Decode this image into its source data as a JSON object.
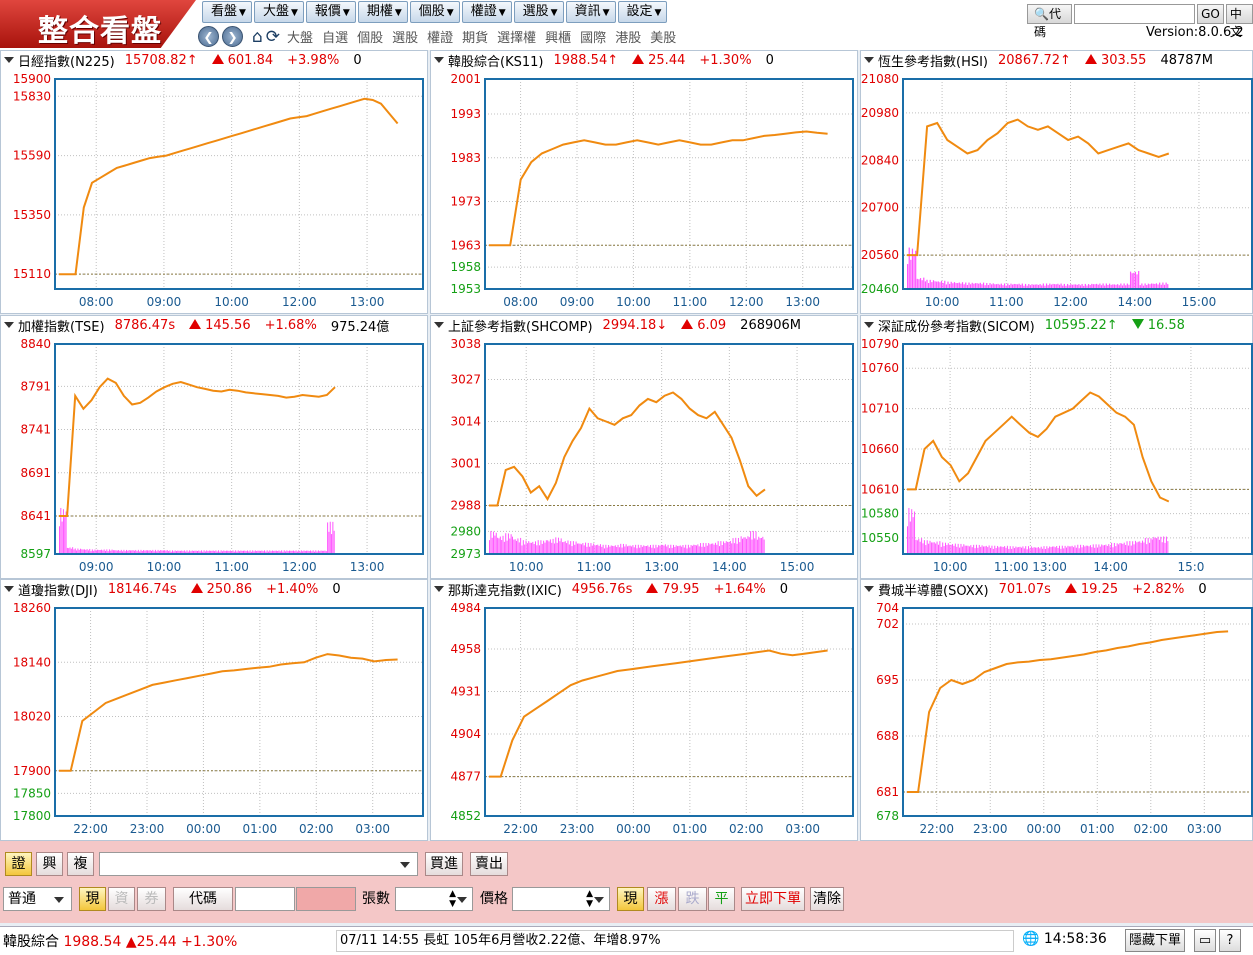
{
  "app": {
    "logo": "整合看盤",
    "version": "Version:8.0.6.2"
  },
  "menu": [
    {
      "label": "看盤"
    },
    {
      "label": "大盤"
    },
    {
      "label": "報價"
    },
    {
      "label": "期權"
    },
    {
      "label": "個股"
    },
    {
      "label": "權證"
    },
    {
      "label": "選股"
    },
    {
      "label": "資訊"
    },
    {
      "label": "設定"
    }
  ],
  "nav_links": [
    "大盤",
    "自選",
    "個股",
    "選股",
    "權證",
    "期貨",
    "選擇權",
    "興櫃",
    "國際",
    "港股",
    "美股"
  ],
  "search": {
    "label": "代碼",
    "value": "",
    "go": "GO",
    "extra": "中文"
  },
  "panels": [
    {
      "id": "n225",
      "name": "日經指數(N225)",
      "price": "15708.82",
      "price_dir": "↑",
      "price_color": "red",
      "chg_dir": "up",
      "change": "601.84",
      "pct": "+3.98%",
      "vol": "0",
      "yticks": [
        "15900",
        "15830",
        "15590",
        "15350",
        "15110"
      ],
      "xticks": [
        "08:00",
        "09:00",
        "10:00",
        "12:00",
        "13:00"
      ],
      "ref": 15110,
      "ymin": 15050,
      "ymax": 15900,
      "series": [
        15110,
        15110,
        15110,
        15380,
        15480,
        15500,
        15520,
        15540,
        15550,
        15560,
        15570,
        15580,
        15585,
        15590,
        15600,
        15610,
        15620,
        15630,
        15640,
        15650,
        15660,
        15670,
        15680,
        15690,
        15700,
        15710,
        15720,
        15730,
        15740,
        15745,
        15750,
        15760,
        15770,
        15780,
        15790,
        15800,
        15810,
        15820,
        15815,
        15800,
        15760,
        15720
      ],
      "volume": []
    },
    {
      "id": "ks11",
      "name": "韓股綜合(KS11)",
      "price": "1988.54",
      "price_dir": "↑",
      "price_color": "red",
      "chg_dir": "up",
      "change": "25.44",
      "pct": "+1.30%",
      "vol": "0",
      "yticks": [
        "2001",
        "1993",
        "1983",
        "1973",
        "1963",
        "1958",
        "1953"
      ],
      "xticks": [
        "08:00",
        "09:00",
        "10:00",
        "11:00",
        "12:00",
        "13:00"
      ],
      "ref": 1963,
      "ymin": 1953,
      "ymax": 2001,
      "series": [
        1963,
        1963,
        1963,
        1978,
        1982,
        1984,
        1985,
        1986,
        1986.5,
        1987,
        1986.5,
        1986,
        1986,
        1986.5,
        1987,
        1986.5,
        1986,
        1986.5,
        1987,
        1986.5,
        1986,
        1986,
        1986.5,
        1987,
        1987,
        1987.5,
        1988,
        1988.2,
        1988.5,
        1988.8,
        1989,
        1988.7,
        1988.5
      ],
      "volume": []
    },
    {
      "id": "hsi",
      "name": "恆生參考指數(HSI)",
      "price": "20867.72",
      "price_dir": "↑",
      "price_color": "red",
      "chg_dir": "up",
      "change": "303.55",
      "pct": "",
      "vol": "48787M",
      "yticks": [
        "21080",
        "20980",
        "20840",
        "20700",
        "20560",
        "20460"
      ],
      "xticks": [
        "10:00",
        "11:00",
        "12:00",
        "14:00",
        "15:00"
      ],
      "ref": 20560,
      "ymin": 20460,
      "ymax": 21080,
      "series": [
        20560,
        20560,
        20940,
        20950,
        20900,
        20880,
        20860,
        20870,
        20900,
        20920,
        20950,
        20960,
        20940,
        20930,
        20940,
        20920,
        20900,
        20910,
        20890,
        20860,
        20870,
        20880,
        20890,
        20870,
        20860,
        20850,
        20860
      ],
      "volume": [
        0.9,
        0.25,
        0.2,
        0.18,
        0.16,
        0.15,
        0.14,
        0.14,
        0.13,
        0.12,
        0.12,
        0.12,
        0.11,
        0.11,
        0.12,
        0.12,
        0.11,
        0.11,
        0.11,
        0.12,
        0.12,
        0.11,
        0.12,
        0.4,
        0.12,
        0.13,
        0.14
      ]
    },
    {
      "id": "tse",
      "name": "加權指數(TSE)",
      "price": "8786.47",
      "price_dir": "s",
      "price_color": "red",
      "chg_dir": "up",
      "change": "145.56",
      "pct": "+1.68%",
      "vol": "975.24億",
      "yticks": [
        "8840",
        "8791",
        "8741",
        "8691",
        "8641",
        "8597"
      ],
      "xticks": [
        "09:00",
        "10:00",
        "11:00",
        "12:00",
        "13:00"
      ],
      "ref": 8641,
      "ymin": 8597,
      "ymax": 8840,
      "series": [
        8641,
        8641,
        8780,
        8765,
        8775,
        8790,
        8800,
        8795,
        8780,
        8770,
        8772,
        8778,
        8785,
        8790,
        8794,
        8796,
        8793,
        8790,
        8788,
        8786,
        8785,
        8787,
        8786,
        8784,
        8783,
        8782,
        8781,
        8780,
        8778,
        8779,
        8781,
        8780,
        8779,
        8781,
        8790
      ],
      "volume": [
        1,
        0.15,
        0.12,
        0.11,
        0.1,
        0.1,
        0.1,
        0.09,
        0.09,
        0.09,
        0.09,
        0.09,
        0.09,
        0.09,
        0.08,
        0.08,
        0.08,
        0.08,
        0.08,
        0.08,
        0.08,
        0.08,
        0.08,
        0.08,
        0.08,
        0.08,
        0.08,
        0.08,
        0.08,
        0.08,
        0.08,
        0.08,
        0.08,
        0.08,
        0.7
      ]
    },
    {
      "id": "shcomp",
      "name": "上証參考指數(SHCOMP)",
      "price": "2994.18",
      "price_dir": "↓",
      "price_color": "red",
      "chg_dir": "up",
      "change": "6.09",
      "pct": "",
      "vol": "268906M",
      "yticks": [
        "3038",
        "3027",
        "3014",
        "3001",
        "2988",
        "2980",
        "2973"
      ],
      "xticks": [
        "10:00",
        "11:00",
        "13:00",
        "14:00",
        "15:00"
      ],
      "ref": 2988,
      "ymin": 2973,
      "ymax": 3038,
      "series": [
        2988,
        2988,
        2999,
        3000,
        2997,
        2992,
        2994,
        2990,
        2995,
        3003,
        3008,
        3012,
        3018,
        3015,
        3014,
        3013,
        3015,
        3016,
        3019,
        3021,
        3020,
        3022,
        3023,
        3021,
        3018,
        3016,
        3015,
        3017,
        3013,
        3009,
        3002,
        2994,
        2991,
        2993
      ],
      "volume": [
        0.5,
        0.4,
        0.45,
        0.35,
        0.3,
        0.28,
        0.3,
        0.33,
        0.36,
        0.3,
        0.28,
        0.25,
        0.24,
        0.22,
        0.2,
        0.2,
        0.22,
        0.2,
        0.2,
        0.2,
        0.2,
        0.22,
        0.2,
        0.2,
        0.2,
        0.22,
        0.24,
        0.25,
        0.28,
        0.3,
        0.35,
        0.4,
        0.5,
        0.4
      ]
    },
    {
      "id": "sicom",
      "name": "深証成份參考指數(SICOM)",
      "price": "10595.22",
      "price_dir": "↑",
      "price_color": "green",
      "chg_dir": "down",
      "change": "16.58",
      "pct": "",
      "vol": "",
      "yticks": [
        "10790",
        "10760",
        "10710",
        "10660",
        "10610",
        "10580",
        "10550"
      ],
      "xticks": [
        "10:00",
        "11:00 13:00",
        "14:00",
        "15:0"
      ],
      "ref": 10610,
      "ymin": 10530,
      "ymax": 10790,
      "series": [
        10610,
        10610,
        10660,
        10670,
        10650,
        10640,
        10620,
        10630,
        10650,
        10670,
        10680,
        10690,
        10700,
        10690,
        10680,
        10675,
        10685,
        10700,
        10705,
        10710,
        10720,
        10730,
        10725,
        10715,
        10705,
        10700,
        10690,
        10650,
        10620,
        10600,
        10595
      ],
      "volume": [
        1,
        0.35,
        0.3,
        0.28,
        0.25,
        0.23,
        0.22,
        0.2,
        0.2,
        0.19,
        0.18,
        0.18,
        0.17,
        0.17,
        0.17,
        0.16,
        0.17,
        0.18,
        0.18,
        0.19,
        0.2,
        0.2,
        0.21,
        0.22,
        0.24,
        0.26,
        0.28,
        0.3,
        0.35,
        0.4,
        0.38
      ]
    },
    {
      "id": "dji",
      "name": "道瓊指數(DJI)",
      "price": "18146.74",
      "price_dir": "s",
      "price_color": "red",
      "chg_dir": "up",
      "change": "250.86",
      "pct": "+1.40%",
      "vol": "0",
      "yticks": [
        "18260",
        "18140",
        "18020",
        "17900",
        "17850",
        "17800"
      ],
      "xticks": [
        "22:00",
        "23:00",
        "00:00",
        "01:00",
        "02:00",
        "03:00"
      ],
      "ref": 17900,
      "ymin": 17800,
      "ymax": 18260,
      "series": [
        17900,
        17900,
        18010,
        18030,
        18050,
        18060,
        18070,
        18080,
        18090,
        18095,
        18100,
        18105,
        18110,
        18115,
        18120,
        18122,
        18125,
        18128,
        18130,
        18135,
        18138,
        18140,
        18150,
        18158,
        18155,
        18150,
        18148,
        18142,
        18145,
        18146
      ],
      "volume": []
    },
    {
      "id": "ixic",
      "name": "那斯達克指數(IXIC)",
      "price": "4956.76",
      "price_dir": "s",
      "price_color": "red",
      "chg_dir": "up",
      "change": "79.95",
      "pct": "+1.64%",
      "vol": "0",
      "yticks": [
        "4984",
        "4958",
        "4931",
        "4904",
        "4877",
        "4852"
      ],
      "xticks": [
        "22:00",
        "23:00",
        "00:00",
        "01:00",
        "02:00",
        "03:00"
      ],
      "ref": 4877,
      "ymin": 4852,
      "ymax": 4984,
      "series": [
        4877,
        4877,
        4900,
        4915,
        4920,
        4925,
        4930,
        4935,
        4938,
        4940,
        4942,
        4944,
        4945,
        4946,
        4947,
        4948,
        4949,
        4950,
        4951,
        4952,
        4953,
        4954,
        4955,
        4956,
        4957,
        4955,
        4954,
        4955,
        4956,
        4957
      ],
      "volume": []
    },
    {
      "id": "soxx",
      "name": "費城半導體(SOXX)",
      "price": "701.07",
      "price_dir": "s",
      "price_color": "red",
      "chg_dir": "up",
      "change": "19.25",
      "pct": "+2.82%",
      "vol": "0",
      "yticks": [
        "704",
        "702",
        "695",
        "688",
        "681",
        "678"
      ],
      "xticks": [
        "22:00",
        "23:00",
        "00:00",
        "01:00",
        "02:00",
        "03:00"
      ],
      "ref": 681,
      "ymin": 678,
      "ymax": 704,
      "series": [
        681,
        681,
        691,
        694,
        695,
        694.5,
        695,
        696,
        696.5,
        697,
        697.2,
        697.3,
        697.5,
        697.6,
        697.8,
        698,
        698.2,
        698.5,
        698.7,
        699,
        699.2,
        699.5,
        699.7,
        700,
        700.2,
        700.4,
        700.6,
        700.8,
        701,
        701.07
      ],
      "volume": []
    }
  ],
  "trade": {
    "tabs": [
      "證",
      "興",
      "複"
    ],
    "account_value": "",
    "buy": "買進",
    "sell": "賣出",
    "order_type": "普通",
    "cash": "現",
    "margin": "資",
    "short": "券",
    "code_label": "代碼",
    "qty_label": "張數",
    "price_label": "價格",
    "price_type": "現",
    "limit_up": "漲",
    "limit_down": "跌",
    "flat": "平",
    "submit": "立即下單",
    "clear": "清除"
  },
  "status": {
    "index_name": "韓股綜合",
    "index_value": "1988.54",
    "index_change": "▲25.44",
    "index_pct": "+1.30%",
    "news": "07/11 14:55  長虹 105年6月營收2.22億、年增8.97%",
    "clock": "14:58:36",
    "hide_order": "隱藏下單"
  },
  "colors": {
    "line": "#f08a10",
    "volume": "#ff55ff",
    "ref": "#8a7a40",
    "grid": "#c0c0c0",
    "frame": "#1a6ea8"
  }
}
